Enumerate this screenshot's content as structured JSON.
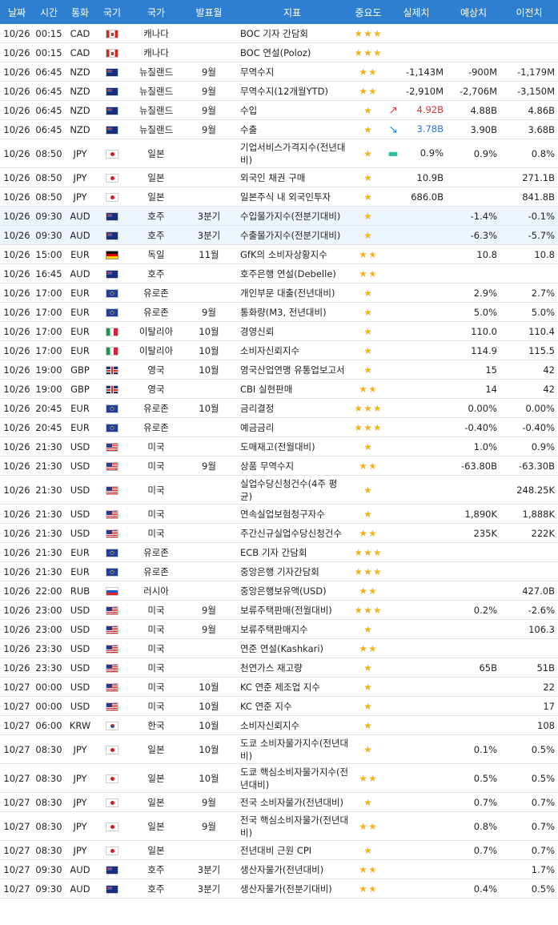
{
  "headers": [
    "날짜",
    "시간",
    "통화",
    "국기",
    "국가",
    "발표월",
    "지표",
    "중요도",
    "실제치",
    "예상치",
    "이전치"
  ],
  "rows": [
    {
      "date": "10/26",
      "time": "00:15",
      "cur": "CAD",
      "flag": "CAD",
      "country": "캐나다",
      "month": "",
      "ind": "BOC 기자 간담회",
      "stars": "★★★",
      "arrow": "",
      "actual": "",
      "forecast": "",
      "prev": ""
    },
    {
      "date": "10/26",
      "time": "00:15",
      "cur": "CAD",
      "flag": "CAD",
      "country": "캐나다",
      "month": "",
      "ind": "BOC 연설(Poloz)",
      "stars": "★★★",
      "arrow": "",
      "actual": "",
      "forecast": "",
      "prev": ""
    },
    {
      "date": "10/26",
      "time": "06:45",
      "cur": "NZD",
      "flag": "NZD",
      "country": "뉴질랜드",
      "month": "9월",
      "ind": "무역수지",
      "stars": "★★",
      "arrow": "",
      "actual": "-1,143M",
      "forecast": "-900M",
      "prev": "-1,179M"
    },
    {
      "date": "10/26",
      "time": "06:45",
      "cur": "NZD",
      "flag": "NZD",
      "country": "뉴질랜드",
      "month": "9월",
      "ind": "무역수지(12개월YTD)",
      "stars": "★★",
      "arrow": "",
      "actual": "-2,910M",
      "forecast": "-2,706M",
      "prev": "-3,150M"
    },
    {
      "date": "10/26",
      "time": "06:45",
      "cur": "NZD",
      "flag": "NZD",
      "country": "뉴질랜드",
      "month": "9월",
      "ind": "수입",
      "stars": "★",
      "arrow": "up",
      "actual": "4.92B",
      "actualColor": "up",
      "forecast": "4.88B",
      "prev": "4.86B"
    },
    {
      "date": "10/26",
      "time": "06:45",
      "cur": "NZD",
      "flag": "NZD",
      "country": "뉴질랜드",
      "month": "9월",
      "ind": "수출",
      "stars": "★",
      "arrow": "down",
      "actual": "3.78B",
      "actualColor": "down",
      "forecast": "3.90B",
      "prev": "3.68B"
    },
    {
      "date": "10/26",
      "time": "08:50",
      "cur": "JPY",
      "flag": "JPY",
      "country": "일본",
      "month": "",
      "ind": "기업서비스가격지수(전년대비)",
      "stars": "★",
      "arrow": "flat",
      "actual": "0.9%",
      "forecast": "0.9%",
      "prev": "0.8%",
      "tall": true
    },
    {
      "date": "10/26",
      "time": "08:50",
      "cur": "JPY",
      "flag": "JPY",
      "country": "일본",
      "month": "",
      "ind": "외국인 채권 구매",
      "stars": "★",
      "arrow": "",
      "actual": "10.9B",
      "forecast": "",
      "prev": "271.1B"
    },
    {
      "date": "10/26",
      "time": "08:50",
      "cur": "JPY",
      "flag": "JPY",
      "country": "일본",
      "month": "",
      "ind": "일본주식 내 외국인투자",
      "stars": "★",
      "arrow": "",
      "actual": "686.0B",
      "forecast": "",
      "prev": "841.8B"
    },
    {
      "date": "10/26",
      "time": "09:30",
      "cur": "AUD",
      "flag": "AUD",
      "country": "호주",
      "month": "3분기",
      "ind": "수입물가지수(전분기대비)",
      "stars": "★",
      "arrow": "",
      "actual": "",
      "forecast": "-1.4%",
      "prev": "-0.1%",
      "hl": true
    },
    {
      "date": "10/26",
      "time": "09:30",
      "cur": "AUD",
      "flag": "AUD",
      "country": "호주",
      "month": "3분기",
      "ind": "수출물가지수(전분기대비)",
      "stars": "★",
      "arrow": "",
      "actual": "",
      "forecast": "-6.3%",
      "prev": "-5.7%",
      "hl": true
    },
    {
      "date": "10/26",
      "time": "15:00",
      "cur": "EUR",
      "flag": "DE",
      "country": "독일",
      "month": "11월",
      "ind": "GfK의 소비자상황지수",
      "stars": "★★",
      "arrow": "",
      "actual": "",
      "forecast": "10.8",
      "prev": "10.8"
    },
    {
      "date": "10/26",
      "time": "16:45",
      "cur": "AUD",
      "flag": "AUD",
      "country": "호주",
      "month": "",
      "ind": "호주은행 연설(Debelle)",
      "stars": "★★",
      "arrow": "",
      "actual": "",
      "forecast": "",
      "prev": ""
    },
    {
      "date": "10/26",
      "time": "17:00",
      "cur": "EUR",
      "flag": "EUR",
      "country": "유로존",
      "month": "",
      "ind": "개인부문 대출(전년대비)",
      "stars": "★",
      "arrow": "",
      "actual": "",
      "forecast": "2.9%",
      "prev": "2.7%"
    },
    {
      "date": "10/26",
      "time": "17:00",
      "cur": "EUR",
      "flag": "EUR",
      "country": "유로존",
      "month": "9월",
      "ind": "통화량(M3, 전년대비)",
      "stars": "★",
      "arrow": "",
      "actual": "",
      "forecast": "5.0%",
      "prev": "5.0%"
    },
    {
      "date": "10/26",
      "time": "17:00",
      "cur": "EUR",
      "flag": "IT",
      "country": "이탈리아",
      "month": "10월",
      "ind": "경영신뢰",
      "stars": "★",
      "arrow": "",
      "actual": "",
      "forecast": "110.0",
      "prev": "110.4"
    },
    {
      "date": "10/26",
      "time": "17:00",
      "cur": "EUR",
      "flag": "IT",
      "country": "이탈리아",
      "month": "10월",
      "ind": "소비자신뢰지수",
      "stars": "★",
      "arrow": "",
      "actual": "",
      "forecast": "114.9",
      "prev": "115.5"
    },
    {
      "date": "10/26",
      "time": "19:00",
      "cur": "GBP",
      "flag": "GBP",
      "country": "영국",
      "month": "10월",
      "ind": "영국산업연맹 유통업보고서",
      "stars": "★",
      "arrow": "",
      "actual": "",
      "forecast": "15",
      "prev": "42"
    },
    {
      "date": "10/26",
      "time": "19:00",
      "cur": "GBP",
      "flag": "GBP",
      "country": "영국",
      "month": "",
      "ind": "CBI 실현판매",
      "stars": "★★",
      "arrow": "",
      "actual": "",
      "forecast": "14",
      "prev": "42"
    },
    {
      "date": "10/26",
      "time": "20:45",
      "cur": "EUR",
      "flag": "EUR",
      "country": "유로존",
      "month": "10월",
      "ind": "금리결정",
      "stars": "★★★",
      "arrow": "",
      "actual": "",
      "forecast": "0.00%",
      "prev": "0.00%"
    },
    {
      "date": "10/26",
      "time": "20:45",
      "cur": "EUR",
      "flag": "EUR",
      "country": "유로존",
      "month": "",
      "ind": "예금금리",
      "stars": "★★★",
      "arrow": "",
      "actual": "",
      "forecast": "-0.40%",
      "prev": "-0.40%"
    },
    {
      "date": "10/26",
      "time": "21:30",
      "cur": "USD",
      "flag": "USD",
      "country": "미국",
      "month": "",
      "ind": "도매재고(전월대비)",
      "stars": "★",
      "arrow": "",
      "actual": "",
      "forecast": "1.0%",
      "prev": "0.9%"
    },
    {
      "date": "10/26",
      "time": "21:30",
      "cur": "USD",
      "flag": "USD",
      "country": "미국",
      "month": "9월",
      "ind": "상품 무역수지",
      "stars": "★★",
      "arrow": "",
      "actual": "",
      "forecast": "-63.80B",
      "prev": "-63.30B"
    },
    {
      "date": "10/26",
      "time": "21:30",
      "cur": "USD",
      "flag": "USD",
      "country": "미국",
      "month": "",
      "ind": "실업수당신청건수(4주 평균)",
      "stars": "★",
      "arrow": "",
      "actual": "",
      "forecast": "",
      "prev": "248.25K",
      "tall": true
    },
    {
      "date": "10/26",
      "time": "21:30",
      "cur": "USD",
      "flag": "USD",
      "country": "미국",
      "month": "",
      "ind": "연속실업보험청구자수",
      "stars": "★",
      "arrow": "",
      "actual": "",
      "forecast": "1,890K",
      "prev": "1,888K"
    },
    {
      "date": "10/26",
      "time": "21:30",
      "cur": "USD",
      "flag": "USD",
      "country": "미국",
      "month": "",
      "ind": "주간신규실업수당신청건수",
      "stars": "★★",
      "arrow": "",
      "actual": "",
      "forecast": "235K",
      "prev": "222K"
    },
    {
      "date": "10/26",
      "time": "21:30",
      "cur": "EUR",
      "flag": "EUR",
      "country": "유로존",
      "month": "",
      "ind": "ECB 기자 간담회",
      "stars": "★★★",
      "arrow": "",
      "actual": "",
      "forecast": "",
      "prev": ""
    },
    {
      "date": "10/26",
      "time": "21:30",
      "cur": "EUR",
      "flag": "EUR",
      "country": "유로존",
      "month": "",
      "ind": "중앙은행 기자간담회",
      "stars": "★★★",
      "arrow": "",
      "actual": "",
      "forecast": "",
      "prev": ""
    },
    {
      "date": "10/26",
      "time": "22:00",
      "cur": "RUB",
      "flag": "RUB",
      "country": "러시아",
      "month": "",
      "ind": "중앙은행보유액(USD)",
      "stars": "★★",
      "arrow": "",
      "actual": "",
      "forecast": "",
      "prev": "427.0B"
    },
    {
      "date": "10/26",
      "time": "23:00",
      "cur": "USD",
      "flag": "USD",
      "country": "미국",
      "month": "9월",
      "ind": "보류주택판매(전월대비)",
      "stars": "★★★",
      "arrow": "",
      "actual": "",
      "forecast": "0.2%",
      "prev": "-2.6%"
    },
    {
      "date": "10/26",
      "time": "23:00",
      "cur": "USD",
      "flag": "USD",
      "country": "미국",
      "month": "9월",
      "ind": "보류주택판매지수",
      "stars": "★",
      "arrow": "",
      "actual": "",
      "forecast": "",
      "prev": "106.3"
    },
    {
      "date": "10/26",
      "time": "23:30",
      "cur": "USD",
      "flag": "USD",
      "country": "미국",
      "month": "",
      "ind": "연준 연설(Kashkari)",
      "stars": "★★",
      "arrow": "",
      "actual": "",
      "forecast": "",
      "prev": ""
    },
    {
      "date": "10/26",
      "time": "23:30",
      "cur": "USD",
      "flag": "USD",
      "country": "미국",
      "month": "",
      "ind": "천연가스 재고량",
      "stars": "★",
      "arrow": "",
      "actual": "",
      "forecast": "65B",
      "prev": "51B"
    },
    {
      "date": "10/27",
      "time": "00:00",
      "cur": "USD",
      "flag": "USD",
      "country": "미국",
      "month": "10월",
      "ind": "KC 연준 제조업 지수",
      "stars": "★",
      "arrow": "",
      "actual": "",
      "forecast": "",
      "prev": "22"
    },
    {
      "date": "10/27",
      "time": "00:00",
      "cur": "USD",
      "flag": "USD",
      "country": "미국",
      "month": "10월",
      "ind": "KC 연준 지수",
      "stars": "★",
      "arrow": "",
      "actual": "",
      "forecast": "",
      "prev": "17"
    },
    {
      "date": "10/27",
      "time": "06:00",
      "cur": "KRW",
      "flag": "KRW",
      "country": "한국",
      "month": "10월",
      "ind": "소비자신뢰지수",
      "stars": "★",
      "arrow": "",
      "actual": "",
      "forecast": "",
      "prev": "108"
    },
    {
      "date": "10/27",
      "time": "08:30",
      "cur": "JPY",
      "flag": "JPY",
      "country": "일본",
      "month": "10월",
      "ind": "도쿄 소비자물가지수(전년대비)",
      "stars": "★",
      "arrow": "",
      "actual": "",
      "forecast": "0.1%",
      "prev": "0.5%",
      "tall": true
    },
    {
      "date": "10/27",
      "time": "08:30",
      "cur": "JPY",
      "flag": "JPY",
      "country": "일본",
      "month": "10월",
      "ind": "도쿄 핵심소비자물가지수(전년대비)",
      "stars": "★★",
      "arrow": "",
      "actual": "",
      "forecast": "0.5%",
      "prev": "0.5%",
      "tall": true
    },
    {
      "date": "10/27",
      "time": "08:30",
      "cur": "JPY",
      "flag": "JPY",
      "country": "일본",
      "month": "9월",
      "ind": "전국 소비자물가(전년대비)",
      "stars": "★",
      "arrow": "",
      "actual": "",
      "forecast": "0.7%",
      "prev": "0.7%"
    },
    {
      "date": "10/27",
      "time": "08:30",
      "cur": "JPY",
      "flag": "JPY",
      "country": "일본",
      "month": "9월",
      "ind": "전국 핵심소비자물가(전년대비)",
      "stars": "★★",
      "arrow": "",
      "actual": "",
      "forecast": "0.8%",
      "prev": "0.7%",
      "tall": true
    },
    {
      "date": "10/27",
      "time": "08:30",
      "cur": "JPY",
      "flag": "JPY",
      "country": "일본",
      "month": "",
      "ind": "전년대비 근원 CPI",
      "stars": "★",
      "arrow": "",
      "actual": "",
      "forecast": "0.7%",
      "prev": "0.7%"
    },
    {
      "date": "10/27",
      "time": "09:30",
      "cur": "AUD",
      "flag": "AUD",
      "country": "호주",
      "month": "3분기",
      "ind": "생산자물가(전년대비)",
      "stars": "★★",
      "arrow": "",
      "actual": "",
      "forecast": "",
      "prev": "1.7%"
    },
    {
      "date": "10/27",
      "time": "09:30",
      "cur": "AUD",
      "flag": "AUD",
      "country": "호주",
      "month": "3분기",
      "ind": "생산자물가(전분기대비)",
      "stars": "★★",
      "arrow": "",
      "actual": "",
      "forecast": "0.4%",
      "prev": "0.5%"
    }
  ]
}
